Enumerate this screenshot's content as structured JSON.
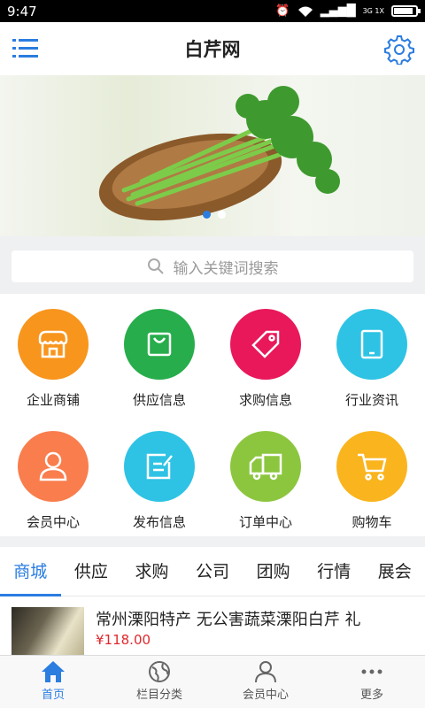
{
  "status": {
    "time": "9:47",
    "network": "3G 1X"
  },
  "appbar": {
    "title": "白芹网",
    "menu_icon": "menu-icon",
    "settings_icon": "gear-icon"
  },
  "banner": {
    "dots": 2,
    "active_dot": 0
  },
  "search": {
    "placeholder": "输入关键词搜索"
  },
  "grid": [
    {
      "label": "企业商铺",
      "color": "#f8951d",
      "icon": "shop-icon"
    },
    {
      "label": "供应信息",
      "color": "#27ad4b",
      "icon": "bag-icon"
    },
    {
      "label": "求购信息",
      "color": "#e8185b",
      "icon": "tag-icon"
    },
    {
      "label": "行业资讯",
      "color": "#2ec3e4",
      "icon": "tablet-icon"
    },
    {
      "label": "会员中心",
      "color": "#f97d4d",
      "icon": "user-icon"
    },
    {
      "label": "发布信息",
      "color": "#2ec3e4",
      "icon": "edit-icon"
    },
    {
      "label": "订单中心",
      "color": "#8cc63f",
      "icon": "truck-icon"
    },
    {
      "label": "购物车",
      "color": "#fab41e",
      "icon": "cart-icon"
    }
  ],
  "tabs": [
    {
      "label": "商城",
      "active": true
    },
    {
      "label": "供应"
    },
    {
      "label": "求购"
    },
    {
      "label": "公司"
    },
    {
      "label": "团购"
    },
    {
      "label": "行情"
    },
    {
      "label": "展会"
    }
  ],
  "products": [
    {
      "name": "常州溧阳特产 无公害蔬菜溧阳白芹 礼",
      "price": "¥118.00"
    }
  ],
  "bottom_nav": [
    {
      "label": "首页",
      "icon": "home-icon",
      "active": true
    },
    {
      "label": "栏目分类",
      "icon": "globe-icon"
    },
    {
      "label": "会员中心",
      "icon": "person-icon"
    },
    {
      "label": "更多",
      "icon": "more-icon"
    }
  ],
  "colors": {
    "accent": "#2b7de0",
    "price": "#e0282d"
  }
}
